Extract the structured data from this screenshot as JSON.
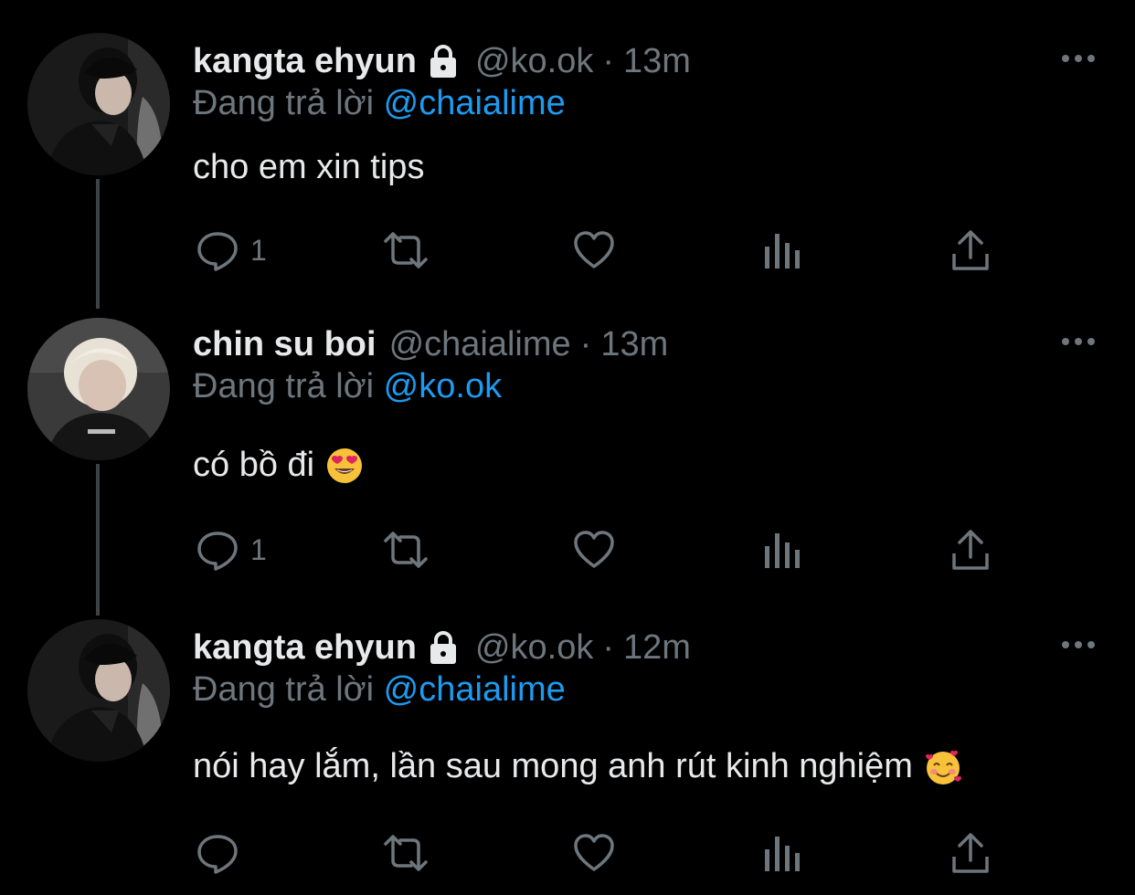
{
  "colors": {
    "background": "#000000",
    "text": "#e7e9ea",
    "muted": "#6e767d",
    "link": "#1d9bf0",
    "thread_line": "#3d4247"
  },
  "tweets": [
    {
      "display_name": "kangta ehyun",
      "locked": true,
      "handle": "@ko.ok",
      "separator": "·",
      "time": "13m",
      "reply_prefix": "Đang trả lời",
      "reply_mention": "@chaialime",
      "text": "cho em xin tips",
      "emoji": "",
      "reply_count": "1",
      "avatar_icon": "avatar-dark-hair-icon"
    },
    {
      "display_name": "chin su boi",
      "locked": false,
      "handle": "@chaialime",
      "separator": "·",
      "time": "13m",
      "reply_prefix": "Đang trả lời",
      "reply_mention": "@ko.ok",
      "text": "có bồ đi",
      "emoji": "heart-eyes-emoji",
      "reply_count": "1",
      "avatar_icon": "avatar-blonde-hair-icon"
    },
    {
      "display_name": "kangta ehyun",
      "locked": true,
      "handle": "@ko.ok",
      "separator": "·",
      "time": "12m",
      "reply_prefix": "Đang trả lời",
      "reply_mention": "@chaialime",
      "text": "nói hay lắm, lần sau mong anh rút kinh nghiệm",
      "emoji": "smiling-face-with-hearts-emoji",
      "reply_count": "",
      "avatar_icon": "avatar-dark-hair-icon"
    }
  ]
}
